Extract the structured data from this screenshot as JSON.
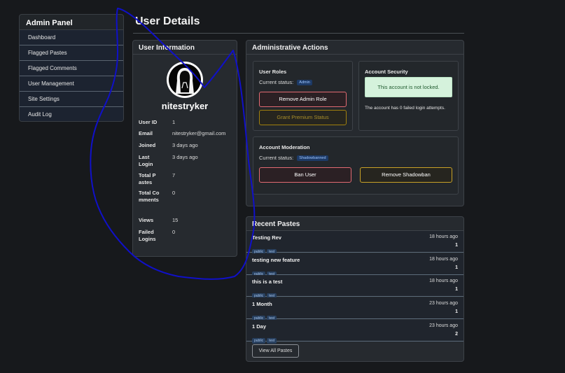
{
  "sidebar": {
    "title": "Admin Panel",
    "items": [
      "Dashboard",
      "Flagged Pastes",
      "Flagged Comments",
      "User Management",
      "Site Settings",
      "Audit Log"
    ]
  },
  "page_title": "User Details",
  "user_info": {
    "heading": "User Information",
    "username": "nitestryker",
    "fields": [
      {
        "key": "User ID",
        "value": "1"
      },
      {
        "key": "Email",
        "value": "nitestryker@gmail.com"
      },
      {
        "key": "Joined",
        "value": "3 days ago"
      },
      {
        "key": "Last Login",
        "value": "3 days ago"
      },
      {
        "key": "Total Pastes",
        "value": "7"
      },
      {
        "key": "Total Comments",
        "value": "0"
      },
      {
        "key": "Views",
        "value": "15"
      },
      {
        "key": "Failed Logins",
        "value": "0"
      }
    ]
  },
  "admin_actions": {
    "heading": "Administrative Actions",
    "roles": {
      "title": "User Roles",
      "status_label": "Current status:",
      "status": "Admin",
      "remove_admin": "Remove Admin Role",
      "grant_premium": "Grant Premium Status"
    },
    "security": {
      "title": "Account Security",
      "alert": "This account is not locked.",
      "note": "The account has 0 failed login attempts."
    },
    "moderation": {
      "title": "Account Moderation",
      "status_label": "Current status:",
      "status": "Shadowbanned",
      "ban": "Ban User",
      "remove_shadowban": "Remove Shadowban"
    }
  },
  "recent_pastes": {
    "heading": "Recent Pastes",
    "items": [
      {
        "title": "Testing Rev",
        "time": "18 hours ago",
        "count": "1",
        "tags": [
          "public",
          "test"
        ]
      },
      {
        "title": "testing new feature",
        "time": "18 hours ago",
        "count": "1",
        "tags": [
          "public",
          "test"
        ]
      },
      {
        "title": "this is a test",
        "time": "18 hours ago",
        "count": "1",
        "tags": [
          "public",
          "test"
        ]
      },
      {
        "title": "1 Month",
        "time": "23 hours ago",
        "count": "1",
        "tags": [
          "public",
          "test"
        ]
      },
      {
        "title": "1 Day",
        "time": "23 hours ago",
        "count": "2",
        "tags": [
          "public",
          "test"
        ]
      }
    ],
    "view_all": "View All Pastes"
  },
  "colors": {
    "accent_red": "#e26a72",
    "accent_yellow": "#c9a227",
    "scribble": "#1010c8"
  }
}
